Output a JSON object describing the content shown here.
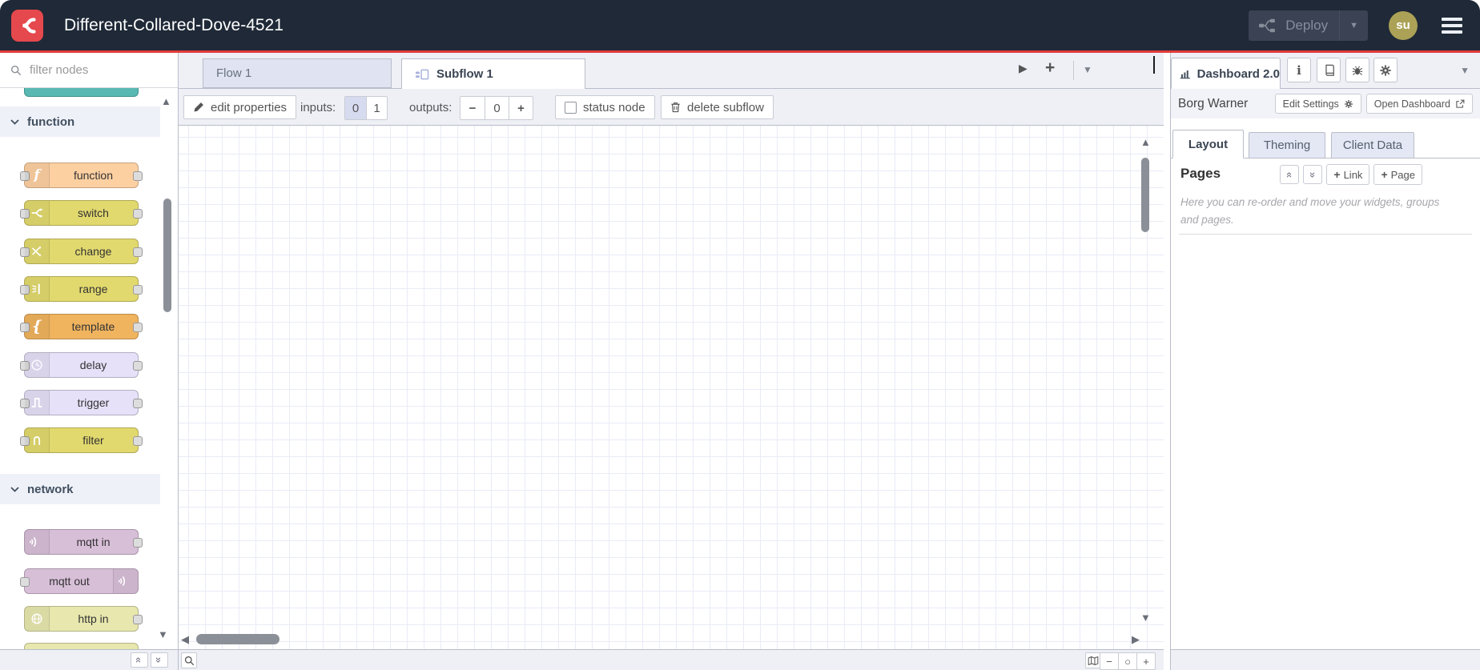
{
  "header": {
    "title": "Different-Collared-Dove-4521",
    "deploy_label": "Deploy",
    "avatar_initials": "su",
    "brand_red": "#e5484d",
    "header_bg": "#1f2937"
  },
  "palette": {
    "search_placeholder": "filter nodes",
    "categories": [
      {
        "label": "function",
        "nodes": [
          {
            "label": "function",
            "color": "#fdd0a2"
          },
          {
            "label": "switch",
            "color": "#e2d96e"
          },
          {
            "label": "change",
            "color": "#e2d96e"
          },
          {
            "label": "range",
            "color": "#e2d96e"
          },
          {
            "label": "template",
            "color": "#f0b35e"
          },
          {
            "label": "delay",
            "color": "#e6e0f8"
          },
          {
            "label": "trigger",
            "color": "#e6e0f8"
          },
          {
            "label": "filter",
            "color": "#e2d96e"
          }
        ]
      },
      {
        "label": "network",
        "nodes": [
          {
            "label": "mqtt in",
            "color": "#d8bfd8"
          },
          {
            "label": "mqtt out",
            "color": "#d8bfd8"
          },
          {
            "label": "http in",
            "color": "#e7e7ae"
          }
        ]
      }
    ]
  },
  "canvas": {
    "tabs": [
      {
        "label": "Flow 1",
        "active": false
      },
      {
        "label": "Subflow 1",
        "active": true
      }
    ],
    "toolbar": {
      "edit_properties_label": "edit properties",
      "inputs_label": "inputs:",
      "input_options": [
        "0",
        "1"
      ],
      "input_selected": "0",
      "outputs_label": "outputs:",
      "outputs_value": "0",
      "status_node_label": "status node",
      "delete_subflow_label": "delete subflow"
    }
  },
  "sidebar": {
    "active_tab": "Dashboard 2.0",
    "instance_name": "Borg Warner",
    "edit_settings_label": "Edit Settings",
    "open_dashboard_label": "Open Dashboard",
    "tabs": [
      {
        "label": "Layout",
        "active": true
      },
      {
        "label": "Theming",
        "active": false
      },
      {
        "label": "Client Data",
        "active": false
      }
    ],
    "pages": {
      "title": "Pages",
      "add_link_label": "Link",
      "add_page_label": "Page",
      "help_text": "Here you can re-order and move your widgets, groups and pages."
    }
  },
  "icons": {
    "function_glyph": "f",
    "template_glyph": "{",
    "info_glyph": "i",
    "deploy_caret": "▼",
    "tab_next": "▶",
    "tab_add": "+",
    "tab_menu_caret": "▼",
    "sidebar_caret": "▼",
    "scroll_up": "▲",
    "scroll_down": "▼",
    "scroll_left": "◀",
    "scroll_right": "▶",
    "zoom_out": "−",
    "zoom_reset": "○",
    "zoom_in": "+",
    "collapse_double_chevron": "«",
    "expand_double_chevron": "»",
    "plus": "+"
  }
}
